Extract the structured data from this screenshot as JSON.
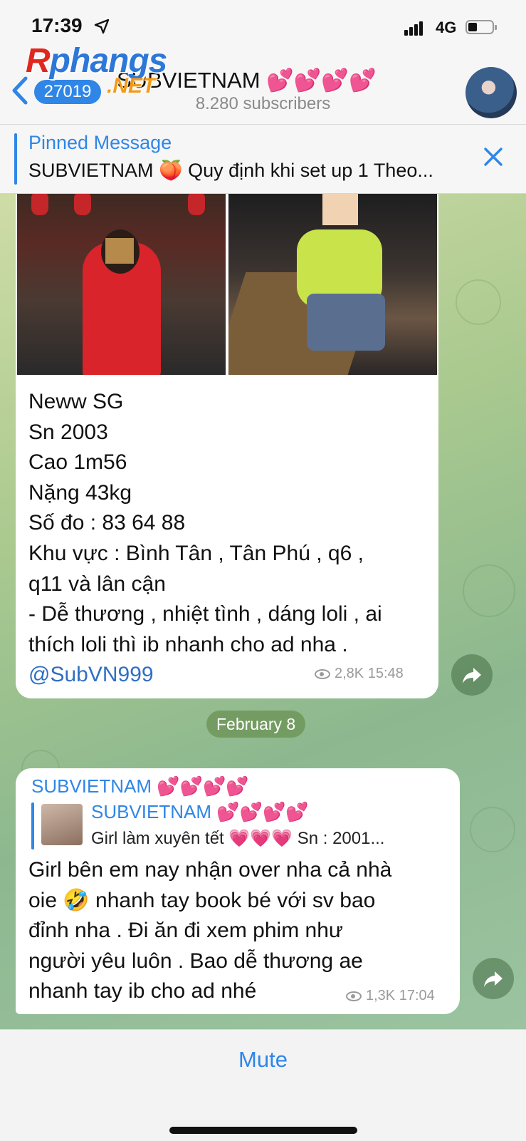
{
  "status_bar": {
    "time": "17:39",
    "network": "4G"
  },
  "watermark": {
    "logo": "Rphangs",
    "suffix": ".NET"
  },
  "header": {
    "unread_count": "27019",
    "channel_title": "SUBVIETNAM 💕💕💕💕",
    "subscribers": "8.280 subscribers"
  },
  "pinned": {
    "title": "Pinned Message",
    "text": "SUBVIETNAM 🍑 Quy định khi set up 1 Theo..."
  },
  "messages": [
    {
      "lines": [
        "Neww SG",
        "Sn 2003",
        "Cao 1m56",
        "Nặng 43kg",
        "Số đo : 83 64 88",
        "Khu vực : Bình Tân , Tân Phú , q6 ,",
        "q11 và lân cận",
        "- Dễ thương , nhiệt tình , dáng loli , ai",
        "thích loli thì ib nhanh cho ad nha ."
      ],
      "mention": "@SubVN999",
      "views": "2,8K",
      "time": "15:48"
    },
    {
      "sender": "SUBVIETNAM 💕💕💕💕",
      "forward_name": "SUBVIETNAM 💕💕💕💕",
      "forward_text": "Girl làm xuyên tết 💗💗💗 Sn : 2001...",
      "lines": [
        "Girl bên em nay nhận over nha cả nhà",
        "oie 🤣 nhanh tay book bé với sv bao",
        "đỉnh nha . Đi ăn đi xem phim như",
        "người yêu luôn . Bao dễ thương ae",
        "nhanh tay ib cho ad nhé"
      ],
      "views": "1,3K",
      "time": "17:04"
    }
  ],
  "date_separator": "February 8",
  "bottom": {
    "mute_label": "Mute"
  },
  "colors": {
    "accent": "#2f86e6",
    "unread_badge": "#2f86e6"
  }
}
